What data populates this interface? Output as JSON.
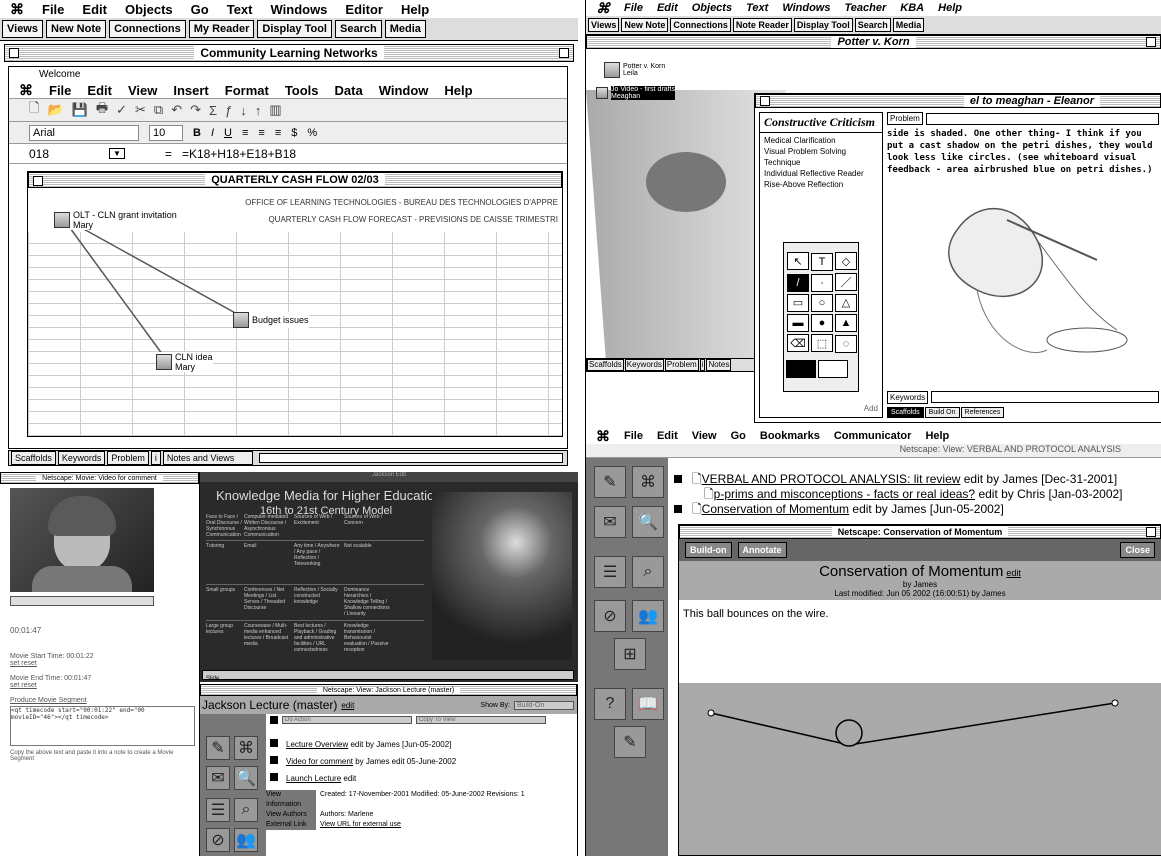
{
  "left_app": {
    "menu": [
      "File",
      "Edit",
      "Objects",
      "Go",
      "Text",
      "Windows",
      "Editor",
      "Help"
    ],
    "toolbar": [
      "Views",
      "New Note",
      "Connections",
      "My Reader",
      "Display Tool",
      "Search",
      "Media"
    ],
    "cln_title": "Community Learning Networks",
    "welcome": "Welcome",
    "excel_menu": [
      "File",
      "Edit",
      "View",
      "Insert",
      "Format",
      "Tools",
      "Data",
      "Window",
      "Help"
    ],
    "font": "Arial",
    "font_size": "10",
    "cell_ref": "018",
    "formula": "=K18+H18+E18+B18",
    "sheet_title": "QUARTERLY CASH FLOW 02/03",
    "sheet_header": "OFFICE OF LEARNING TECHNOLOGIES - BUREAU DES TECHNOLOGIES D'APPRE",
    "sheet_sub": "QUARTERLY CASH FLOW FORECAST  -  PREVISIONS DE CAISSE TRIMESTRI",
    "nodes": [
      {
        "title": "OLT - CLN grant invitation",
        "author": "Mary"
      },
      {
        "title": "Budget issues",
        "author": ""
      },
      {
        "title": "CLN idea",
        "author": "Mary"
      }
    ],
    "bottom_tabs": [
      "Scaffolds",
      "Keywords",
      "Problem",
      "i",
      "Notes and Views"
    ]
  },
  "right_app": {
    "menu": [
      "File",
      "Edit",
      "Objects",
      "Text",
      "Windows",
      "Teacher",
      "KBA",
      "Help"
    ],
    "toolbar": [
      "Views",
      "New Note",
      "Connections",
      "Note Reader",
      "Display Tool",
      "Search",
      "Media"
    ],
    "window_title": "Potter v. Korn",
    "node1": "Potter v. Korn\nLeila",
    "node2": "Jo Video - first drafts\nMeaghan",
    "note_title": "el to meaghan - Eleanor",
    "criticism_title": "Constructive Criticism",
    "criticism_items": [
      "Medical Clarification",
      "Visual Problem Solving",
      "Technique",
      "Individual Reflective Reader",
      "Rise-Above Reflection"
    ],
    "problem_label": "Problem",
    "note_text": "side is shaded. One other thing- I think if you put a cast shadow on the petri dishes, they would look less like circles. (see whiteboard visual feedback - area airbrushed blue on petri dishes.)",
    "keywords_label": "Keywords",
    "note_tabs": [
      "Scaffolds",
      "Build On",
      "References"
    ],
    "add_label": "Add",
    "bottom_tabs": [
      "Scaffolds",
      "Keywords",
      "Problem",
      "i",
      "Notes"
    ]
  },
  "video_window": {
    "title": "Netscape: Movie: Video for comment",
    "start": "Movie Start Time: 00:01:22",
    "end": "Movie End Time: 00:01:47",
    "set": "set reset",
    "current": "00:01:47",
    "produce": "Produce Movie Segment",
    "code": "<qt timecode start=\"00:01:22\" end=\"00 movieID=\"46\"></qt timecode>",
    "hint": "Copy the above text and paste it into a note to create a Movie Segment"
  },
  "slide": {
    "window_title": "Jackson Edit",
    "title": "Knowledge Media for Higher Education:",
    "subtitle": "16th to 21st Century Model",
    "col_heads": [
      "Face to Face / Oral Discourse / Synchronous Communication",
      "Computer-mediated Written Discourse / Asynchronous Communication",
      "Sources of Web / Excitement",
      "Sources of Web / Concern"
    ],
    "rows": [
      [
        "Tutoring",
        "Email",
        "Any time / Anywhere / Any pace / Reflection / Teleworking",
        "Not scalable"
      ],
      [
        "Small groups",
        "Conferences / Net Meetings / List Serves / Threaded Discourse",
        "Reflection / Socially constructed knowledge",
        "Dominance hierarchies / Knowledge Telling / Shallow connections / Linearity"
      ],
      [
        "Large group lectures",
        "Courseware / Multi-media enhanced lectures / Broadcast media",
        "Best lectures / Playback / Grading and administrative facilities / URL connectedness",
        "Knowledge transmission / Behaviourist evaluation / Passive reception"
      ]
    ],
    "slide_control": "Slide"
  },
  "lecture": {
    "window_title": "Netscape: View: Jackson Lecture (master)",
    "heading": "Jackson Lecture (master)",
    "edit": "edit",
    "show_by": "Show By:",
    "show_val": "Build-On",
    "action": "Do Action",
    "copy": "Copy To View",
    "items": [
      {
        "link": "Lecture Overview",
        "rest": " edit by James [Jun-05-2002]"
      },
      {
        "link": "Video for comment",
        "rest": " by James edit 05-June-2002"
      },
      {
        "link": "Launch Lecture",
        "rest": " edit"
      }
    ],
    "info_labels": [
      "View Information",
      "View Authors",
      "External Link"
    ],
    "info_vals": [
      "Created: 17-November-2001  Modified: 05-June-2002  Revisions: 1",
      "Authors: Marlene",
      "View URL for external use"
    ]
  },
  "netscape_bottom": {
    "menu": [
      "File",
      "Edit",
      "View",
      "Go",
      "Bookmarks",
      "Communicator",
      "Help"
    ],
    "view_title": "Netscape: View: VERBAL AND PROTOCOL ANALYSIS",
    "items": [
      {
        "link": "VERBAL AND PROTOCOL ANALYSIS: lit review",
        "rest": " edit by James [Dec-31-2001]"
      },
      {
        "link": "p-prims and misconceptions - facts or real ideas?",
        "rest": " edit by Chris [Jan-03-2002]"
      },
      {
        "link": "Conservation of Momentum",
        "rest": " edit by James [Jun-05-2002]"
      }
    ],
    "inner_title": "Netscape: Conservation of Momentum",
    "build_on": "Build-on",
    "annotate": "Annotate",
    "close": "Close",
    "heading": "Conservation of Momentum",
    "edit": "edit",
    "by": "by James",
    "modified": "Last modified: Jun 05 2002 (16:00:51) by James",
    "body": "This ball bounces on the wire."
  }
}
